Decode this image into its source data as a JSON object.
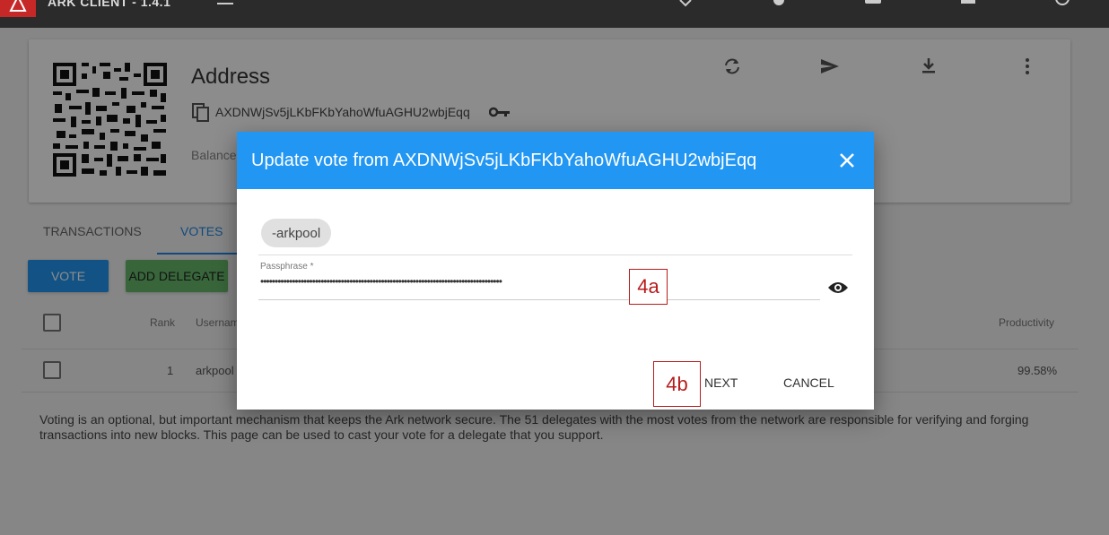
{
  "app": {
    "title": "ARK CLIENT - 1.4.1"
  },
  "wallet": {
    "title": "Address",
    "address": "AXDNWjSv5jLKbFKbYahoWfuAGHU2wbjEqq",
    "balance_label": "Balance"
  },
  "tabs": [
    {
      "label": "TRANSACTIONS"
    },
    {
      "label": "VOTES"
    }
  ],
  "buttons": {
    "vote": "VOTE",
    "add_delegate": "ADD DELEGATE"
  },
  "table": {
    "headers": {
      "rank": "Rank",
      "username": "Usernam",
      "productivity": "Productivity"
    },
    "rows": [
      {
        "rank": "1",
        "username": "arkpool",
        "productivity": "99.58%"
      }
    ]
  },
  "note": "Voting is an optional, but important mechanism that keeps the Ark network secure. The 51 delegates with the most votes from the network are responsible for verifying and forging transactions into new blocks. This page can be used to cast your vote for a delegate that you support.",
  "dialog": {
    "title": "Update vote from AXDNWjSv5jLKbFKbYahoWfuAGHU2wbjEqq",
    "chip": "-arkpool",
    "passphrase_label": "Passphrase *",
    "passphrase_value": "••••••••••••••••••••••••••••••••••••••••••••••••••••••••••••••••••••••••••••••••••••",
    "next": "NEXT",
    "cancel": "CANCEL"
  },
  "callouts": {
    "a": "4a",
    "b": "4b"
  },
  "colors": {
    "accent": "#2196f3",
    "topbar": "#2b2b2b",
    "callout": "#b71c1c",
    "add_delegate": "#66bb6a"
  },
  "icons": [
    "ark-logo-icon",
    "menu-icon",
    "copy-icon",
    "key-icon",
    "refresh-icon",
    "send-icon",
    "download-icon",
    "more-vert-icon",
    "close-icon",
    "eye-icon"
  ]
}
